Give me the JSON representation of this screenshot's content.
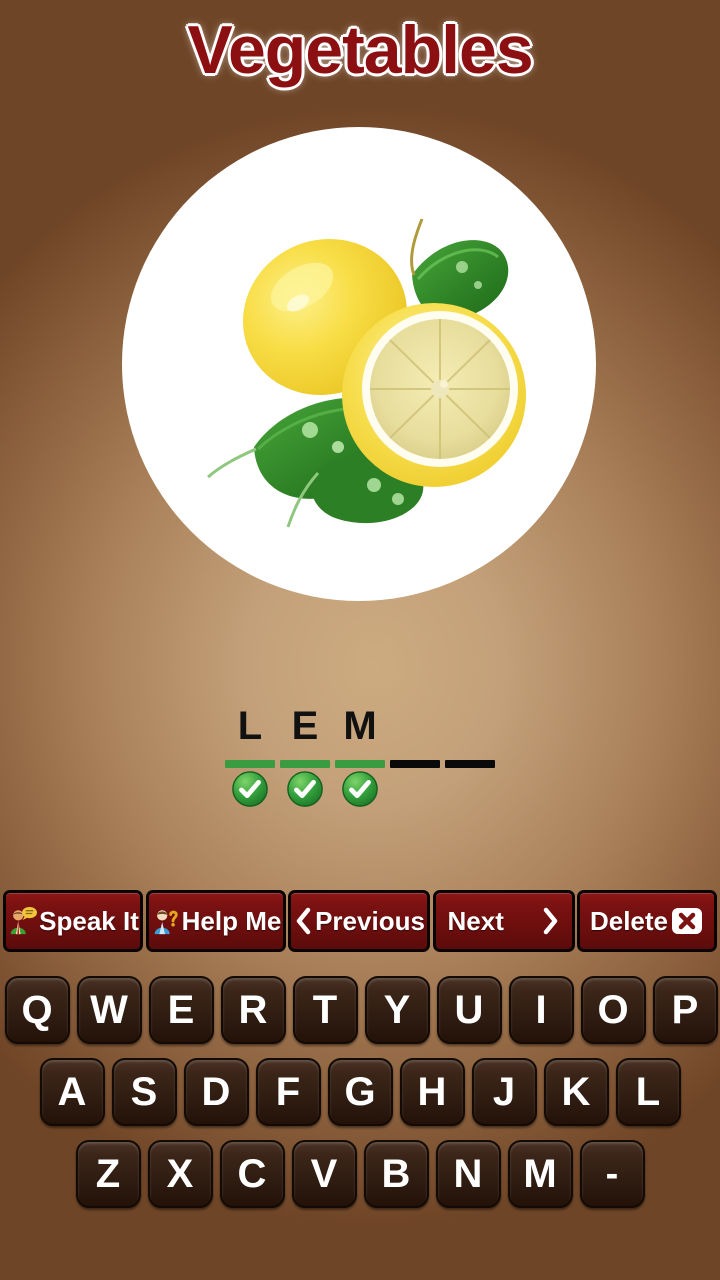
{
  "app": {
    "title": "Vegetables",
    "title_color": "#8c0f12",
    "background_center_color": "#c9a87c",
    "background_edge_color": "#6f4527"
  },
  "picture": {
    "name": "lemon-picture",
    "subject": "lemons",
    "frame_shape": "circle",
    "frame_color": "#ffffff"
  },
  "answer": {
    "word_length": 5,
    "letters": [
      "L",
      "E",
      "M",
      "",
      ""
    ],
    "slots": [
      {
        "filled": true,
        "letter": "L",
        "check": true
      },
      {
        "filled": true,
        "letter": "E",
        "check": true
      },
      {
        "filled": true,
        "letter": "M",
        "check": true
      },
      {
        "filled": false,
        "letter": "",
        "check": false
      },
      {
        "filled": false,
        "letter": "",
        "check": false
      }
    ],
    "filled_slot_color": "#3a9c41",
    "empty_slot_color": "#0a0a0a",
    "check_icon": "check-circle-icon",
    "check_color": "#2e9e3a"
  },
  "buttons": [
    {
      "id": "speak-it",
      "label": "Speak It",
      "icon": "speaking-person-icon",
      "icon_side": "left"
    },
    {
      "id": "help-me",
      "label": "Help Me",
      "icon": "person-question-icon",
      "icon_side": "left"
    },
    {
      "id": "previous",
      "label": "Previous",
      "icon": "chevron-left-icon",
      "icon_side": "left"
    },
    {
      "id": "next",
      "label": "Next",
      "icon": "chevron-right-icon",
      "icon_side": "right"
    },
    {
      "id": "delete",
      "label": "Delete",
      "icon": "close-x-icon",
      "icon_side": "right"
    }
  ],
  "button_color": "#7d1212",
  "keyboard": {
    "row1": [
      "Q",
      "W",
      "E",
      "R",
      "T",
      "Y",
      "U",
      "I",
      "O",
      "P"
    ],
    "row2": [
      "A",
      "S",
      "D",
      "F",
      "G",
      "H",
      "J",
      "K",
      "L"
    ],
    "row3": [
      "Z",
      "X",
      "C",
      "V",
      "B",
      "N",
      "M",
      "-"
    ],
    "key_color": "#2c1a10",
    "key_text_color": "#ffffff"
  }
}
